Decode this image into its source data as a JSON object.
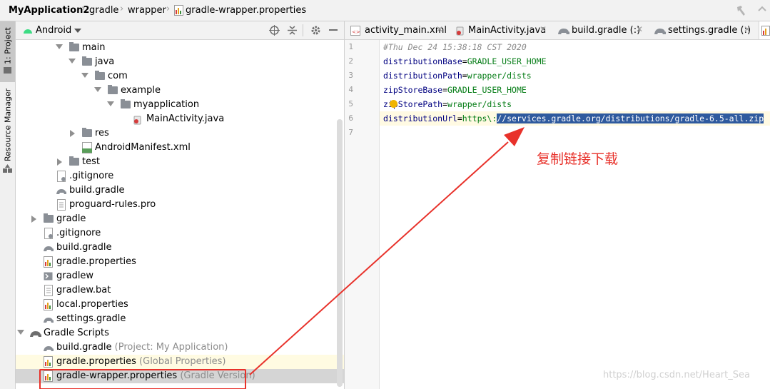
{
  "breadcrumb": {
    "project": "MyApplication2",
    "parts": [
      "gradle",
      "wrapper",
      "gradle-wrapper.properties"
    ]
  },
  "tool_strip": {
    "project_tab": "1: Project",
    "resource_tab": "Resource Manager"
  },
  "project_panel": {
    "view_selector": "Android",
    "tree": [
      {
        "label": "main",
        "kind": "folder",
        "arrow": "down"
      },
      {
        "label": "java",
        "kind": "folder",
        "arrow": "down"
      },
      {
        "label": "com",
        "kind": "folder",
        "arrow": "down"
      },
      {
        "label": "example",
        "kind": "folder",
        "arrow": "down"
      },
      {
        "label": "myapplication",
        "kind": "folder",
        "arrow": "down"
      },
      {
        "label": "MainActivity.java",
        "kind": "java"
      },
      {
        "label": "res",
        "kind": "folder",
        "arrow": "right"
      },
      {
        "label": "AndroidManifest.xml",
        "kind": "manifest"
      },
      {
        "label": "test",
        "kind": "folder",
        "arrow": "right"
      },
      {
        "label": ".gitignore",
        "kind": "text"
      },
      {
        "label": "build.gradle",
        "kind": "gradle"
      },
      {
        "label": "proguard-rules.pro",
        "kind": "text"
      },
      {
        "label": "gradle",
        "kind": "folder",
        "arrow": "right"
      },
      {
        "label": ".gitignore",
        "kind": "text"
      },
      {
        "label": "build.gradle",
        "kind": "gradle"
      },
      {
        "label": "gradle.properties",
        "kind": "properties"
      },
      {
        "label": "gradlew",
        "kind": "script"
      },
      {
        "label": "gradlew.bat",
        "kind": "text"
      },
      {
        "label": "local.properties",
        "kind": "properties"
      },
      {
        "label": "settings.gradle",
        "kind": "gradle"
      },
      {
        "label": "Gradle Scripts",
        "kind": "gradle-root",
        "arrow": "down"
      },
      {
        "label": "build.gradle",
        "hint": "(Project: My Application)",
        "kind": "gradle"
      },
      {
        "label": "gradle.properties",
        "hint": "(Global Properties)",
        "kind": "properties"
      },
      {
        "label": "gradle-wrapper.properties",
        "hint": "(Gradle Version)",
        "kind": "properties",
        "selected": true
      }
    ]
  },
  "editor": {
    "tabs": [
      {
        "label": "activity_main.xml",
        "icon": "xml-file-icon"
      },
      {
        "label": "MainActivity.java",
        "icon": "java-file-icon"
      },
      {
        "label": "build.gradle (:)",
        "icon": "gradle-icon"
      },
      {
        "label": "settings.gradle (:)",
        "icon": "gradle-icon"
      }
    ],
    "line_numbers": [
      "1",
      "2",
      "3",
      "4",
      "5",
      "6",
      "7"
    ],
    "lines": [
      {
        "comment": "#Thu Dec 24 15:38:18 CST 2020"
      },
      {
        "key": "distributionBase",
        "value": "GRADLE_USER_HOME"
      },
      {
        "key": "distributionPath",
        "value": "wrapper/dists"
      },
      {
        "key": "zipStoreBase",
        "value": "GRADLE_USER_HOME"
      },
      {
        "key": "zipStorePath",
        "value": "wrapper/dists"
      },
      {
        "key": "distributionUrl",
        "value_plain": "https\\:",
        "value_selected": "//services.gradle.org/distributions/gradle-6.5-all.zip"
      },
      {
        "comment": ""
      }
    ]
  },
  "annotation": {
    "text": "复制链接下载",
    "color": "#e8312a"
  },
  "watermark": "https://blog.csdn.net/Heart_Sea",
  "colors": {
    "selection": "#2f5a9e",
    "selected_row": "#d5d5d5",
    "highlight_row": "#fffbe2",
    "caret_row": "#fffae3"
  }
}
